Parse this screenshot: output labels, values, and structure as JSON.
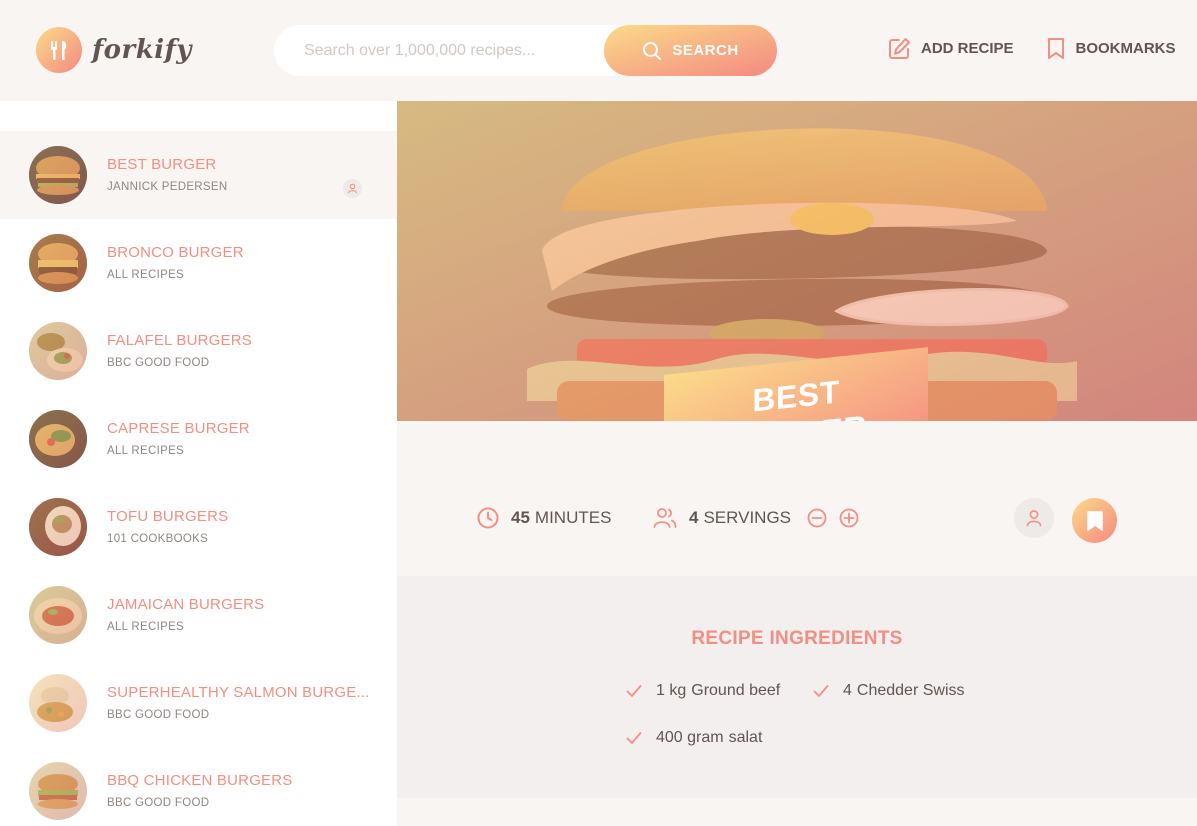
{
  "header": {
    "logo_text": "forkify",
    "search": {
      "placeholder": "Search over 1,000,000 recipes...",
      "value": "",
      "button_label": "SEARCH"
    },
    "nav": {
      "add_recipe_label": "ADD RECIPE",
      "bookmarks_label": "BOOKMARKS"
    }
  },
  "results": [
    {
      "title": "BEST BURGER",
      "publisher": "JANNICK PEDERSEN",
      "active": true,
      "user_generated": true
    },
    {
      "title": "BRONCO BURGER",
      "publisher": "ALL RECIPES"
    },
    {
      "title": "FALAFEL BURGERS",
      "publisher": "BBC GOOD FOOD"
    },
    {
      "title": "CAPRESE BURGER",
      "publisher": "ALL RECIPES"
    },
    {
      "title": "TOFU BURGERS",
      "publisher": "101 COOKBOOKS"
    },
    {
      "title": "JAMAICAN BURGERS",
      "publisher": "ALL RECIPES"
    },
    {
      "title": "SUPERHEALTHY SALMON BURGE...",
      "publisher": "BBC GOOD FOOD"
    },
    {
      "title": "BBQ CHICKEN BURGERS",
      "publisher": "BBC GOOD FOOD"
    }
  ],
  "recipe": {
    "title": "BEST BURGER",
    "cooking_time": "45",
    "cooking_time_unit": "MINUTES",
    "servings": "4",
    "servings_unit": "SERVINGS",
    "ingredients_heading": "RECIPE INGREDIENTS",
    "ingredients": [
      {
        "quantity": "1 kg",
        "description": "Ground beef"
      },
      {
        "quantity": "4",
        "description": "Chedder Swiss"
      },
      {
        "quantity": "400 gram",
        "description": "salat"
      }
    ]
  },
  "colors": {
    "primary": "#f38e82",
    "gradient_start": "#fbdb89",
    "gradient_end": "#f48982",
    "text": "#615551",
    "bg": "#f9f5f3"
  },
  "icons": [
    "fork-knife-logo-icon",
    "search-icon",
    "edit-icon",
    "bookmark-icon",
    "user-icon",
    "clock-icon",
    "users-icon",
    "minus-circle-icon",
    "plus-circle-icon",
    "check-icon"
  ]
}
